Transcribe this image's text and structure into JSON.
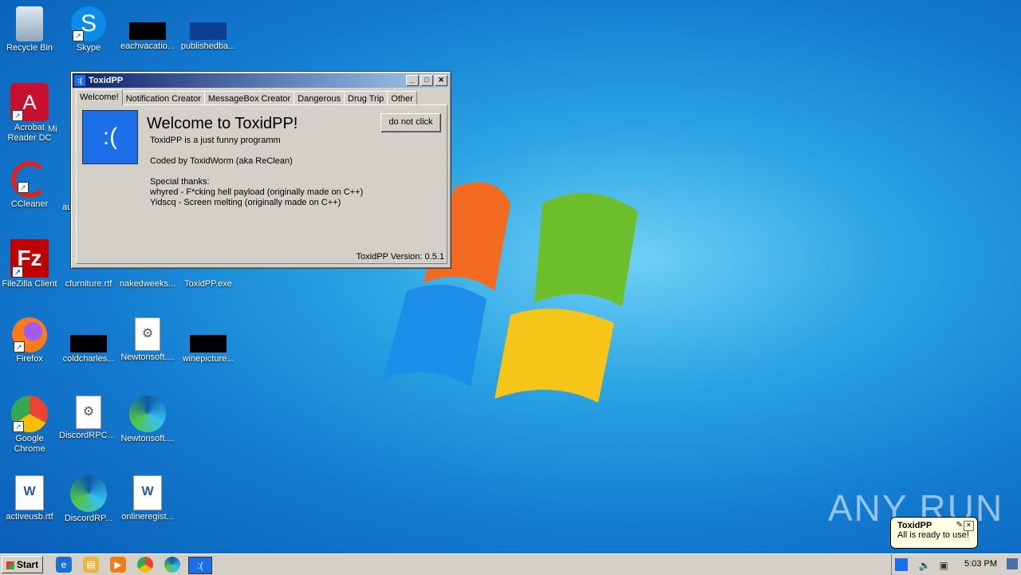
{
  "desktop": {
    "icons": [
      {
        "label": "Recycle Bin"
      },
      {
        "label": "Skype"
      },
      {
        "label": "eachvacatio..."
      },
      {
        "label": "publishedba..."
      },
      {
        "label": "Acrobat Reader DC"
      },
      {
        "label": "Mi"
      },
      {
        "label": "CCleaner"
      },
      {
        "label": "au"
      },
      {
        "label": "FileZilla Client"
      },
      {
        "label": "cfurniture.rtf"
      },
      {
        "label": "nakedweeks..."
      },
      {
        "label": "ToxidPP.exe"
      },
      {
        "label": "Firefox"
      },
      {
        "label": "coldcharles..."
      },
      {
        "label": "Newtonsoft...."
      },
      {
        "label": "winepicture..."
      },
      {
        "label": "Google Chrome"
      },
      {
        "label": "DiscordRPC.dll"
      },
      {
        "label": "Newtonsoft...."
      },
      {
        "label": "activeusb.rtf"
      },
      {
        "label": "DiscordRP..."
      },
      {
        "label": "onlineregist..."
      }
    ]
  },
  "window": {
    "title": "ToxidPP",
    "tabs": [
      "Welcome!",
      "Notification Creator",
      "MessageBox Creator",
      "Dangerous",
      "Drug Trip",
      "Other"
    ],
    "icon_text": ":(",
    "heading": "Welcome to ToxidPP!",
    "line1": "ToxidPP is a just funny programm",
    "line2": "Coded by ToxidWorm (aka ReClean)",
    "thanks_title": "Special thanks:",
    "thanks1": "whyred - F*cking hell payload (originally made on C++)",
    "thanks2": "Yidscq - Screen melting (originally made on C++)",
    "button": "do not click",
    "version": "ToxidPP Version: 0.5.1"
  },
  "taskbar": {
    "start_label": "Start",
    "clock": "5:03 PM"
  },
  "balloon": {
    "title": "ToxidPP",
    "message": "All is ready to use!"
  },
  "watermark": "ANY RUN"
}
